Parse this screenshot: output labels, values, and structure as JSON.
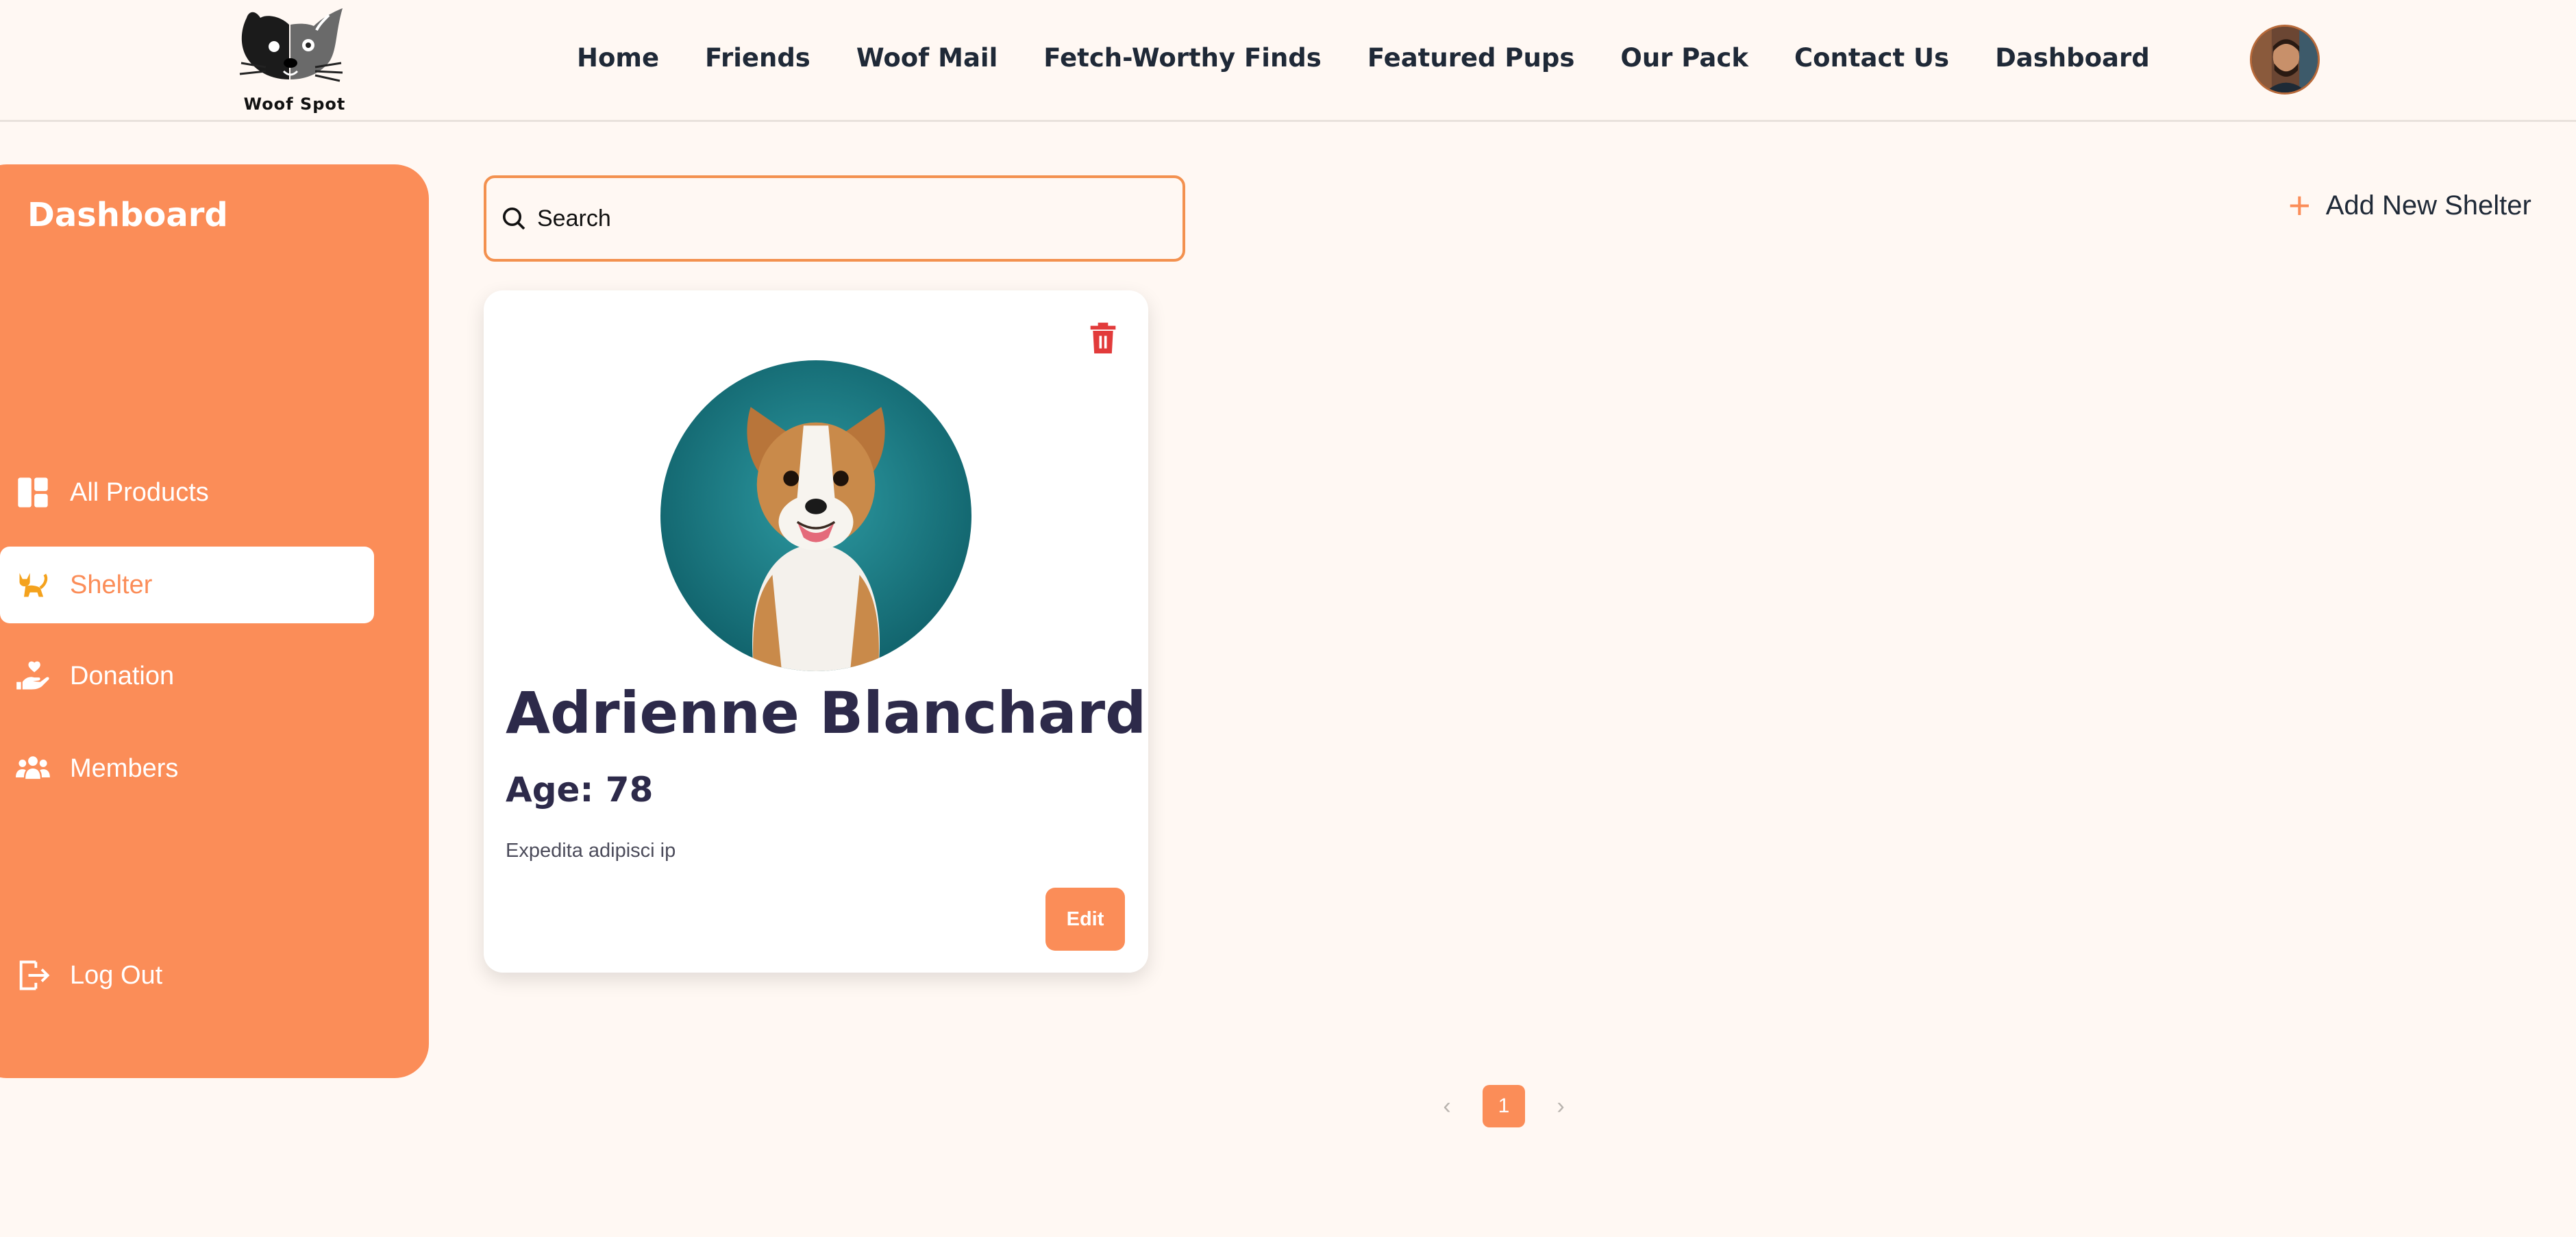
{
  "header": {
    "logo_text": "Woof Spot",
    "nav": [
      "Home",
      "Friends",
      "Woof Mail",
      "Fetch-Worthy Finds",
      "Featured Pups",
      "Our Pack",
      "Contact Us",
      "Dashboard"
    ]
  },
  "sidebar": {
    "title": "Dashboard",
    "items": [
      {
        "label": "All Products",
        "icon": "dashboard-icon"
      },
      {
        "label": "Shelter",
        "icon": "cat-icon"
      },
      {
        "label": "Donation",
        "icon": "hand-heart-icon"
      },
      {
        "label": "Members",
        "icon": "users-icon"
      }
    ],
    "logout_label": "Log Out"
  },
  "search": {
    "placeholder": "Search"
  },
  "add_shelter_label": "Add New Shelter",
  "card": {
    "name": "Adrienne Blanchard",
    "age": "Age: 78",
    "description": "Expedita adipisci ip",
    "edit_label": "Edit"
  },
  "pagination": {
    "prev": "‹",
    "current": "1",
    "next": "›"
  },
  "colors": {
    "accent": "#fb8d58",
    "background": "#fff8f3",
    "heading": "#2d2a4a",
    "trash": "#e23b3b"
  }
}
